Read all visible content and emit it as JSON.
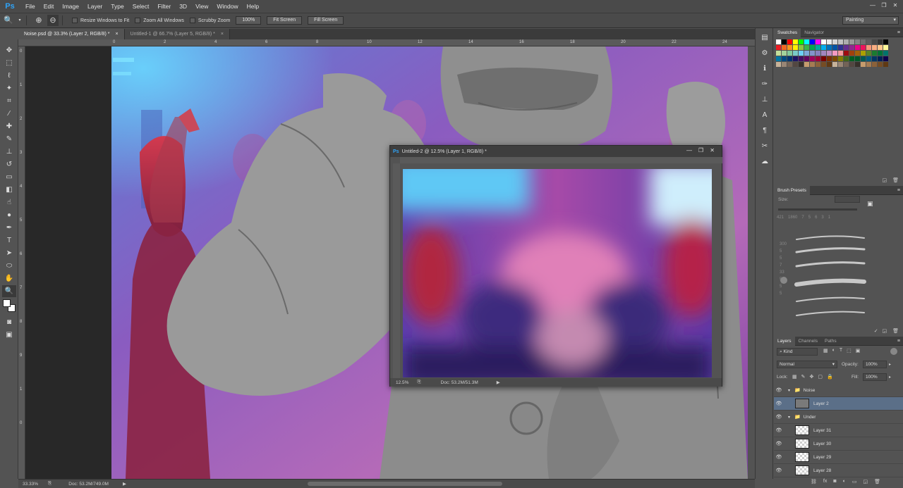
{
  "app": {
    "logo": "Ps"
  },
  "menu": [
    "File",
    "Edit",
    "Image",
    "Layer",
    "Type",
    "Select",
    "Filter",
    "3D",
    "View",
    "Window",
    "Help"
  ],
  "window_controls": [
    "—",
    "❐",
    "✕"
  ],
  "options": {
    "resize_windows": "Resize Windows to Fit",
    "zoom_all": "Zoom All Windows",
    "scrubby_zoom": "Scrubby Zoom",
    "zoom_value": "100%",
    "fit_screen": "Fit Screen",
    "fill_screen": "Fill Screen",
    "workspace": "Painting"
  },
  "tabs": [
    {
      "label": "Noise.psd @ 33.3% (Layer 2, RGB/8) *",
      "active": true
    },
    {
      "label": "Untitled-1 @ 66.7% (Layer 5, RGB/8) *",
      "active": false
    }
  ],
  "ruler_h": [
    "0",
    "2",
    "4",
    "6",
    "8",
    "10",
    "12",
    "14",
    "16",
    "18",
    "20",
    "22",
    "24"
  ],
  "ruler_v": [
    "0",
    "1",
    "2",
    "3",
    "4",
    "5",
    "6",
    "7",
    "8",
    "9",
    "1",
    "0"
  ],
  "status": {
    "zoom": "33.33%",
    "doc": "Doc: 53.2M/749.0M"
  },
  "floating_window": {
    "title": "Untitled-2 @ 12.5% (Layer 1, RGB/8) *",
    "zoom": "12.5%",
    "doc": "Doc: 53.2M/51.3M"
  },
  "panels": {
    "swatches_tab": "Swatches",
    "navigator_tab": "Navigator",
    "brush_presets_tab": "Brush Presets",
    "brush_size_label": "Size:",
    "brush_sizes": [
      "421",
      "1860",
      "7",
      "5",
      "6",
      "3",
      "1"
    ],
    "brush_sizes_2": [
      "300",
      "5",
      "5",
      "7",
      "33",
      "5",
      "5",
      "5"
    ],
    "layers_tab": "Layers",
    "channels_tab": "Channels",
    "paths_tab": "Paths",
    "kind_label": "Kind",
    "blend_mode": "Normal",
    "opacity_label": "Opacity:",
    "opacity_value": "100%",
    "lock_label": "Lock:",
    "fill_label": "Fill:",
    "fill_value": "100%",
    "layers": [
      {
        "name": "Noise",
        "type": "group",
        "selected": false
      },
      {
        "name": "Layer 2",
        "type": "layer",
        "selected": true
      },
      {
        "name": "Under",
        "type": "group",
        "selected": false
      },
      {
        "name": "Layer 31",
        "type": "layer",
        "selected": false
      },
      {
        "name": "Layer 30",
        "type": "layer",
        "selected": false
      },
      {
        "name": "Layer 29",
        "type": "layer",
        "selected": false
      },
      {
        "name": "Layer 28",
        "type": "layer",
        "selected": false
      }
    ]
  },
  "swatch_colors": [
    "#ffffff",
    "#000000",
    "#ff0000",
    "#ffff00",
    "#00ff00",
    "#00ffff",
    "#0000ff",
    "#ff00ff",
    "#ffffff",
    "#ebebeb",
    "#d6d6d6",
    "#c2c2c2",
    "#adadad",
    "#999999",
    "#858585",
    "#707070",
    "#5c5c5c",
    "#474747",
    "#333333",
    "#000000",
    "#ed1c24",
    "#f26522",
    "#f7941d",
    "#fff200",
    "#8dc63f",
    "#39b54a",
    "#00a651",
    "#00a99d",
    "#00aeef",
    "#0072bc",
    "#0054a6",
    "#2e3192",
    "#662d91",
    "#92278f",
    "#ec008c",
    "#ed145b",
    "#f69679",
    "#f9ad81",
    "#fdc68a",
    "#fff799",
    "#c4df9b",
    "#a3d39c",
    "#82ca9c",
    "#7accc8",
    "#6dcff6",
    "#7da7d9",
    "#8393ca",
    "#8781bd",
    "#a186be",
    "#bd8cbf",
    "#f49ac1",
    "#f5989d",
    "#9e0b0f",
    "#a0410d",
    "#a36209",
    "#aba000",
    "#598527",
    "#1a7b30",
    "#007236",
    "#00746b",
    "#0076a3",
    "#004b80",
    "#003471",
    "#1b1464",
    "#440e62",
    "#630460",
    "#9e005d",
    "#9e0039",
    "#790000",
    "#7b2e00",
    "#7d4900",
    "#827b00",
    "#406618",
    "#005e20",
    "#005826",
    "#005952",
    "#005b7f",
    "#003663",
    "#002157",
    "#0d004c",
    "#c7b299",
    "#998675",
    "#736357",
    "#534741",
    "#37302a",
    "#c69c6d",
    "#a67c52",
    "#8c6239",
    "#754c24",
    "#603913",
    "#c7b299",
    "#998675",
    "#736357",
    "#534741",
    "#37302a",
    "#c69c6d",
    "#a67c52",
    "#8c6239",
    "#754c24",
    "#603913"
  ]
}
